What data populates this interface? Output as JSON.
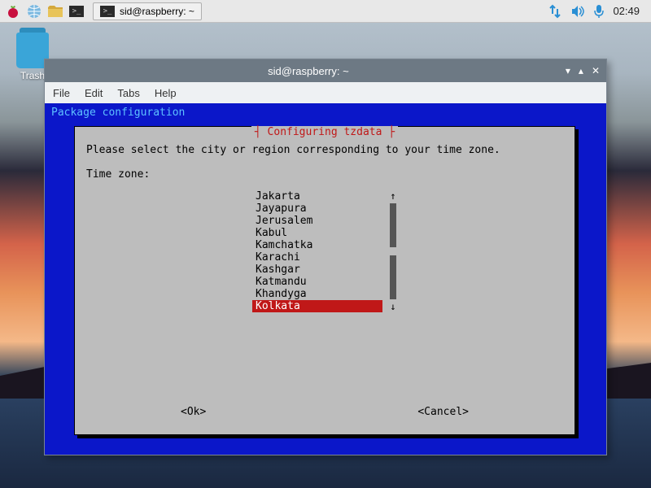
{
  "taskbar": {
    "task_title": "sid@raspberry: ~",
    "clock": "02:49"
  },
  "desktop": {
    "trash_label": "Trash"
  },
  "window": {
    "title": "sid@raspberry: ~",
    "menu": {
      "file": "File",
      "edit": "Edit",
      "tabs": "Tabs",
      "help": "Help"
    }
  },
  "terminal": {
    "header": "Package configuration"
  },
  "dialog": {
    "title": "Configuring tzdata",
    "prompt": "Please select the city or region corresponding to your time zone.",
    "label": "Time zone:",
    "items": [
      "Jakarta",
      "Jayapura",
      "Jerusalem",
      "Kabul",
      "Kamchatka",
      "Karachi",
      "Kashgar",
      "Katmandu",
      "Khandyga",
      "Kolkata"
    ],
    "selected_index": 9,
    "ok": "<Ok>",
    "cancel": "<Cancel>",
    "scroll_up": "↑",
    "scroll_down": "↓"
  }
}
